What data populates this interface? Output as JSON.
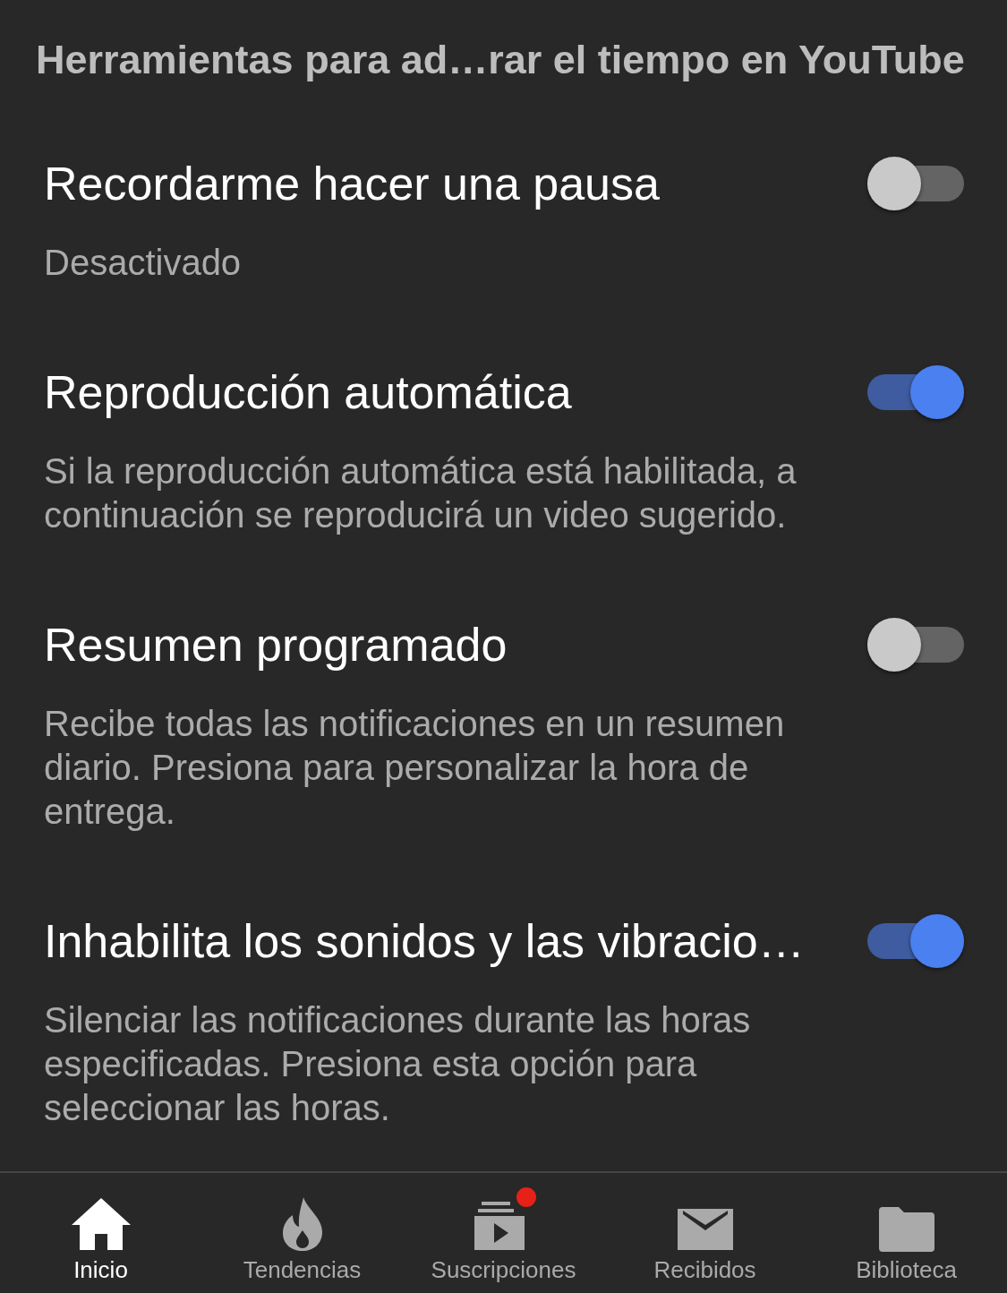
{
  "header": {
    "title": "Herramientas para ad…rar el tiempo en YouTube"
  },
  "settings": [
    {
      "title": "Recordarme hacer una pausa",
      "description": "Desactivado",
      "on": false
    },
    {
      "title": "Reproducción automática",
      "description": "Si la reproducción automática está habilitada, a continuación se reproducirá un video sugerido.",
      "on": true
    },
    {
      "title": "Resumen programado",
      "description": "Recibe todas las notificaciones en un resumen diario. Presiona para personalizar la hora de entrega.",
      "on": false
    },
    {
      "title": "Inhabilita los sonidos y las vibracio…",
      "description": "Silenciar las notificaciones durante las horas especificadas. Presiona esta opción para seleccionar las horas.",
      "on": true
    }
  ],
  "bottom_nav": [
    {
      "label": "Inicio",
      "selected": true,
      "notification_dot": false
    },
    {
      "label": "Tendencias",
      "selected": false,
      "notification_dot": false
    },
    {
      "label": "Suscripciones",
      "selected": false,
      "notification_dot": true
    },
    {
      "label": "Recibidos",
      "selected": false,
      "notification_dot": false
    },
    {
      "label": "Biblioteca",
      "selected": false,
      "notification_dot": false
    }
  ]
}
